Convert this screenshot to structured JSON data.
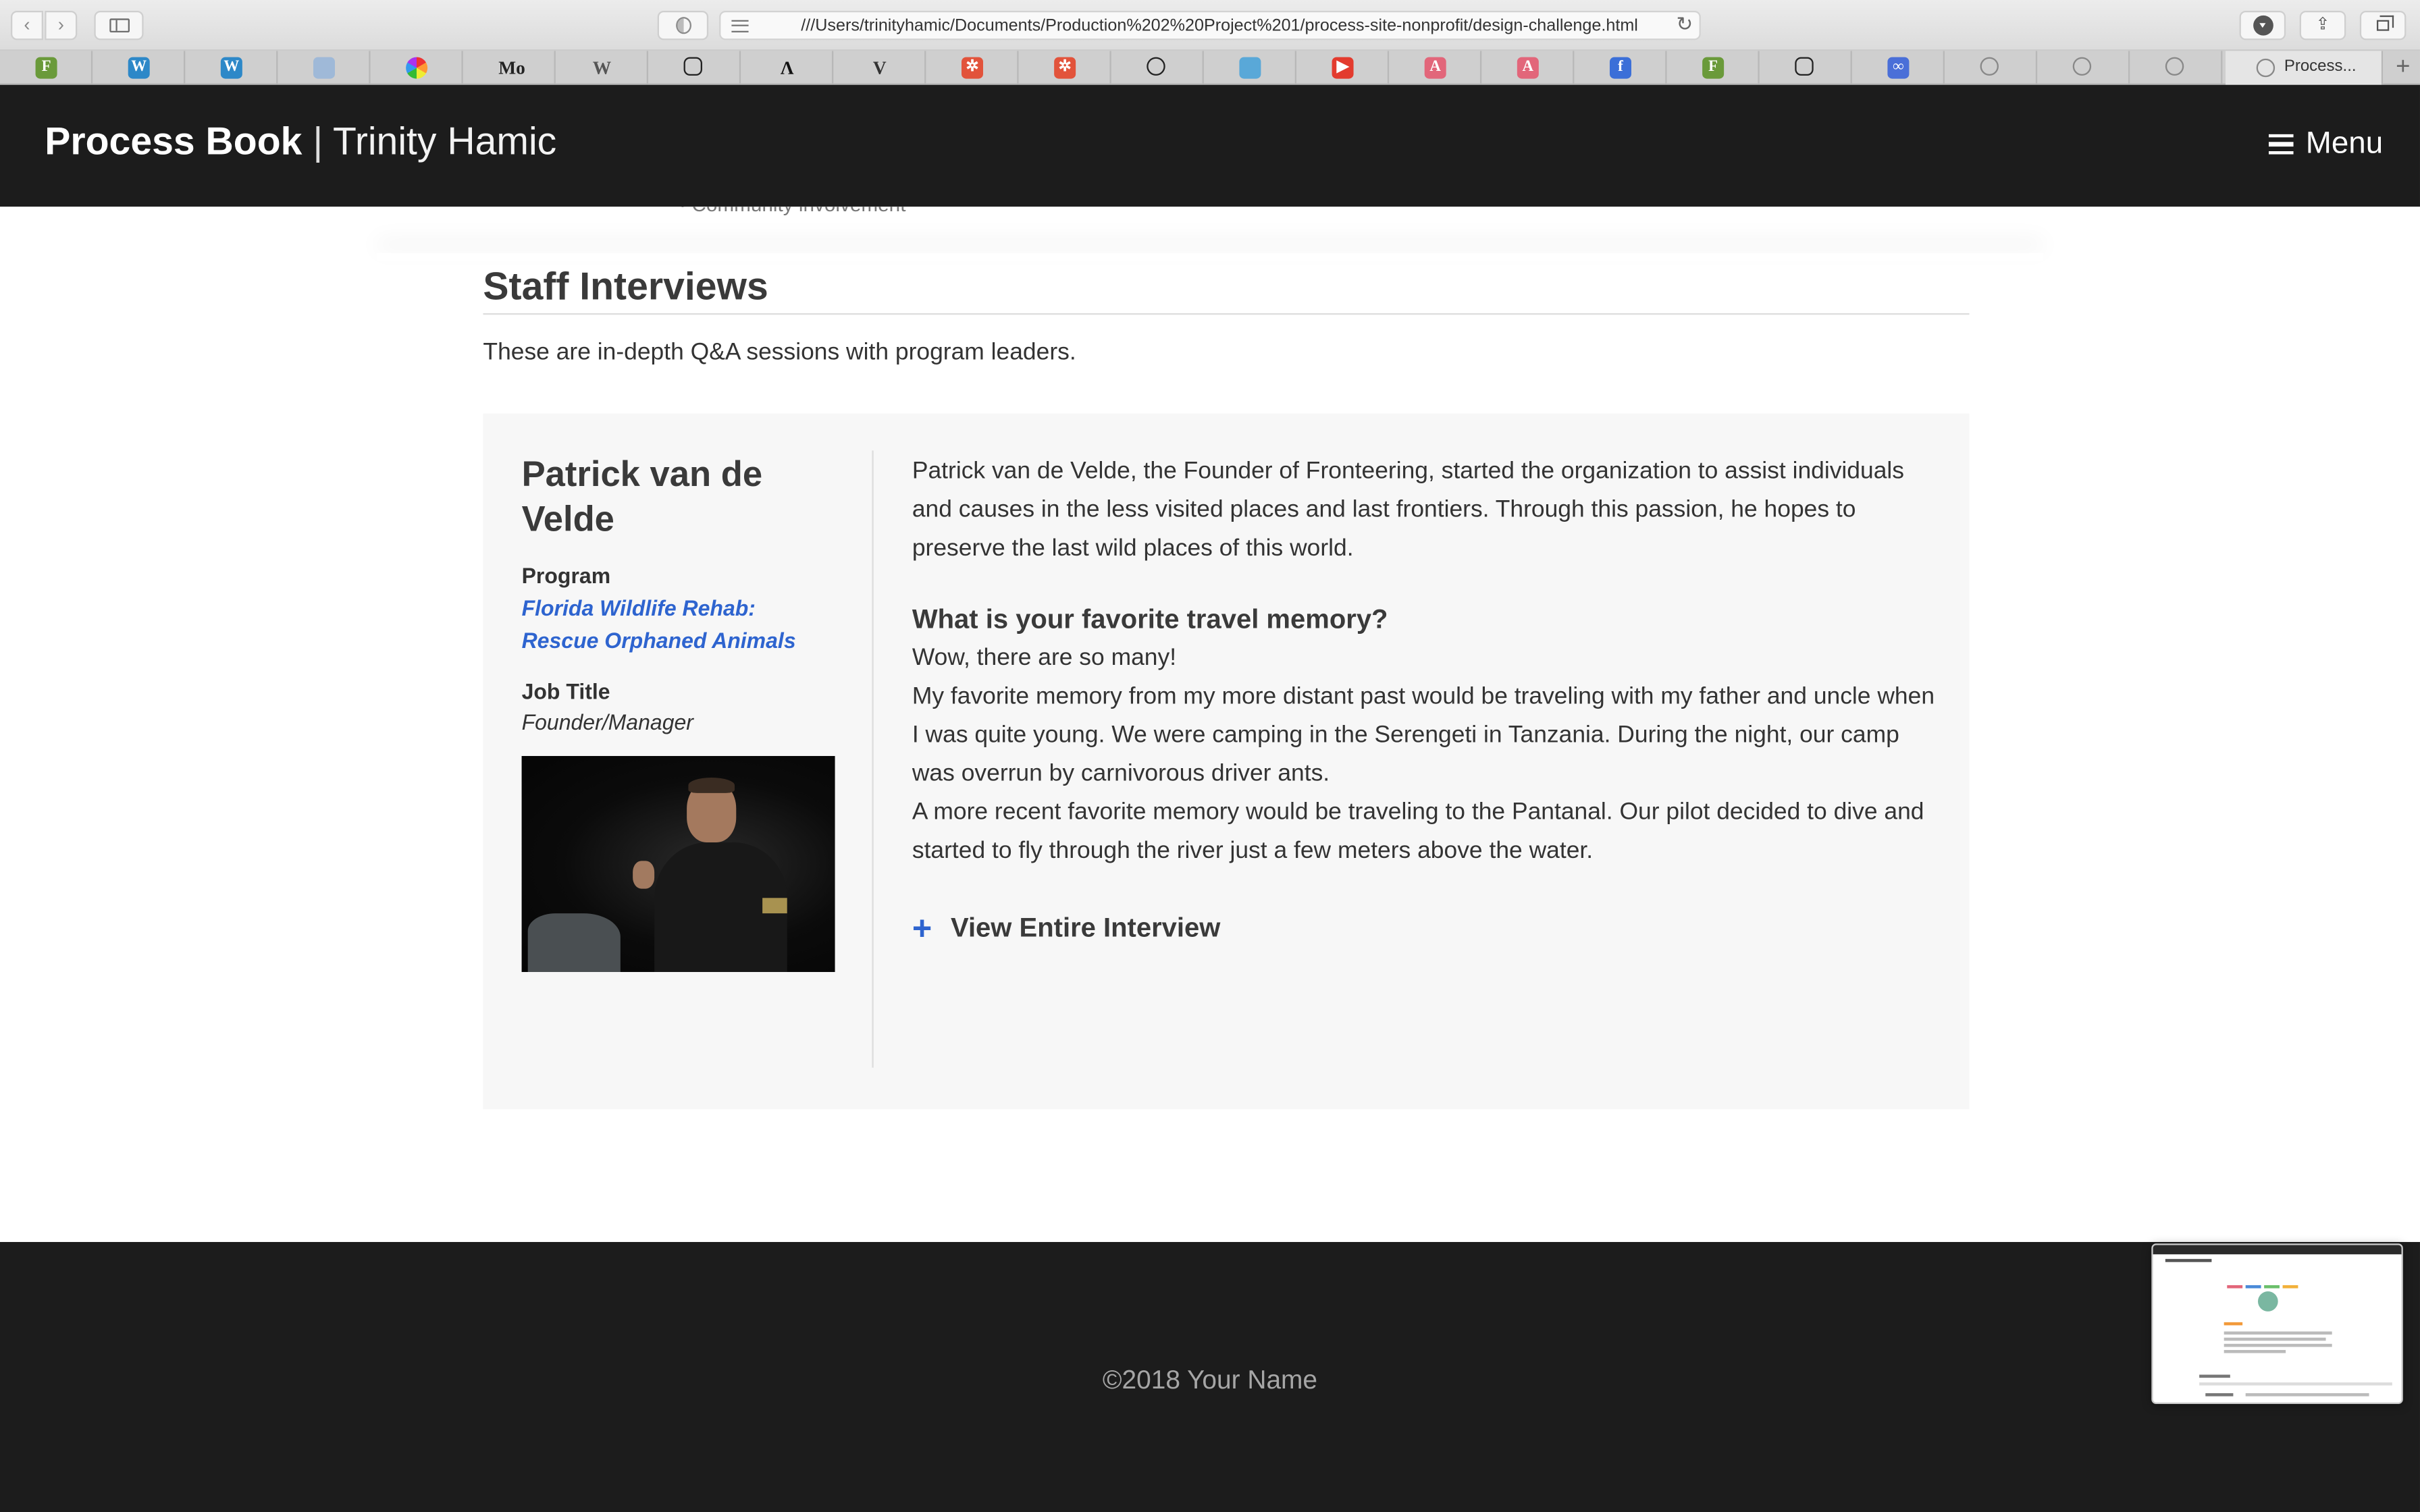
{
  "browser": {
    "url": "///Users/trinityhamic/Documents/Production%202%20Project%201/process-site-nonprofit/design-challenge.html",
    "nav_back_icon": "chevron-left-icon",
    "nav_forward_icon": "chevron-right-icon",
    "tabs": [
      {
        "icon": "fronteering-icon",
        "color": "#6a9a3a",
        "glyph": "F"
      },
      {
        "icon": "wordpress-icon",
        "color": "#2d88c8",
        "glyph": "W"
      },
      {
        "icon": "wordpress-icon",
        "color": "#2d88c8",
        "glyph": "W"
      },
      {
        "icon": "shield-icon",
        "color": "#9fb9d8",
        "glyph": ""
      },
      {
        "icon": "color-wheel-icon",
        "color": "#b760c7",
        "glyph": ""
      },
      {
        "icon": "mo-icon",
        "color": "#222222",
        "glyph": "Mo"
      },
      {
        "icon": "wikipedia-icon",
        "color": "#555555",
        "glyph": "W"
      },
      {
        "icon": "instagram-icon",
        "color": "#222222",
        "glyph": ""
      },
      {
        "icon": "lambda-icon",
        "color": "#111111",
        "glyph": "Λ"
      },
      {
        "icon": "v-icon",
        "color": "#333333",
        "glyph": "V"
      },
      {
        "icon": "asterisk-icon",
        "color": "#e2533b",
        "glyph": "✲"
      },
      {
        "icon": "asterisk-icon",
        "color": "#e2533b",
        "glyph": "✲"
      },
      {
        "icon": "github-icon",
        "color": "#222222",
        "glyph": ""
      },
      {
        "icon": "blue-square-icon",
        "color": "#59a8d8",
        "glyph": ""
      },
      {
        "icon": "youtube-icon",
        "color": "#e33b2e",
        "glyph": "▶"
      },
      {
        "icon": "pink-a-icon",
        "color": "#e2667a",
        "glyph": "A"
      },
      {
        "icon": "pink-a-icon",
        "color": "#e2667a",
        "glyph": "A"
      },
      {
        "icon": "facebook-icon",
        "color": "#3b6fd8",
        "glyph": "f"
      },
      {
        "icon": "fronteering-icon",
        "color": "#6a9a3a",
        "glyph": "F"
      },
      {
        "icon": "instagram-icon",
        "color": "#222222",
        "glyph": ""
      },
      {
        "icon": "link-icon",
        "color": "#4a6fd8",
        "glyph": "∞"
      },
      {
        "icon": "compass-icon",
        "color": "#888888",
        "glyph": ""
      },
      {
        "icon": "compass-icon",
        "color": "#888888",
        "glyph": ""
      },
      {
        "icon": "compass-icon",
        "color": "#888888",
        "glyph": ""
      }
    ],
    "active_tab_title": "Process..."
  },
  "header": {
    "title": "Process Book",
    "separator": "|",
    "author": "Trinity Hamic",
    "menu_label": "Menu"
  },
  "content": {
    "clipped_bullet": "Community involvement",
    "section_title": "Staff Interviews",
    "section_desc": "These are in-depth Q&A sessions with program leaders.",
    "interview": {
      "name": "Patrick van de Velde",
      "program_label": "Program",
      "program_value": "Florida Wildlife Rehab: Rescue Orphaned Animals",
      "job_label": "Job Title",
      "job_value": "Founder/Manager",
      "intro": "Patrick van de Velde, the Founder of Fronteering, started the organization to assist individuals and causes in the less visited places and last frontiers. Through this passion, he hopes to preserve the last wild places of this world.",
      "question": "What is your favorite travel memory?",
      "answers": [
        "Wow, there are so many!",
        "My favorite memory from my more distant past would be traveling with my father and uncle when I was quite young. We were camping in the Serengeti in Tanzania. During the night, our camp was overrun by carnivorous driver ants.",
        "A more recent favorite memory would be traveling to the Pantanal. Our pilot decided to dive and started to fly through the river just a few meters above the water."
      ],
      "view_more": "View Entire Interview"
    }
  },
  "footer": {
    "copyright": "©2018 Your Name"
  },
  "colors": {
    "header_bg": "#1c1c1c",
    "accent_link": "#2e64cf",
    "card_bg": "#f7f7f7"
  }
}
